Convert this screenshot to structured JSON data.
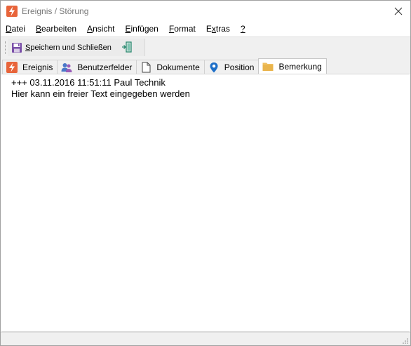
{
  "window": {
    "title": "Ereignis / Störung"
  },
  "menu": {
    "items": [
      {
        "label": "Datei",
        "accel": "D",
        "rest": "atei"
      },
      {
        "label": "Bearbeiten",
        "accel": "B",
        "rest": "earbeiten"
      },
      {
        "label": "Ansicht",
        "accel": "A",
        "rest": "nsicht"
      },
      {
        "label": "Einfügen",
        "accel": "E",
        "rest": "infügen"
      },
      {
        "label": "Format",
        "accel": "F",
        "rest": "ormat"
      },
      {
        "label": "Extras",
        "pre": "E",
        "accel": "x",
        "rest": "tras"
      },
      {
        "label": "?",
        "accel": "?",
        "rest": ""
      }
    ]
  },
  "toolbar": {
    "save_close_accel": "S",
    "save_close_rest": "peichern und Schließen",
    "save_icon": "floppy-disk-icon",
    "exit_icon": "exit-door-icon"
  },
  "tabs": [
    {
      "label": "Ereignis",
      "icon": "lightning-icon",
      "active": false
    },
    {
      "label": "Benutzerfelder",
      "icon": "users-icon",
      "active": false
    },
    {
      "label": "Dokumente",
      "icon": "document-icon",
      "active": false
    },
    {
      "label": "Position",
      "icon": "map-pin-icon",
      "active": false
    },
    {
      "label": "Bemerkung",
      "icon": "folder-icon",
      "active": true
    }
  ],
  "content": {
    "lines": [
      "+++ 03.11.2016 11:51:11 Paul Technik",
      "Hier kann ein freier Text eingegeben werden"
    ]
  },
  "colors": {
    "accent": "#e8643a",
    "folder": "#f0c060",
    "pin": "#1e6fc8"
  }
}
